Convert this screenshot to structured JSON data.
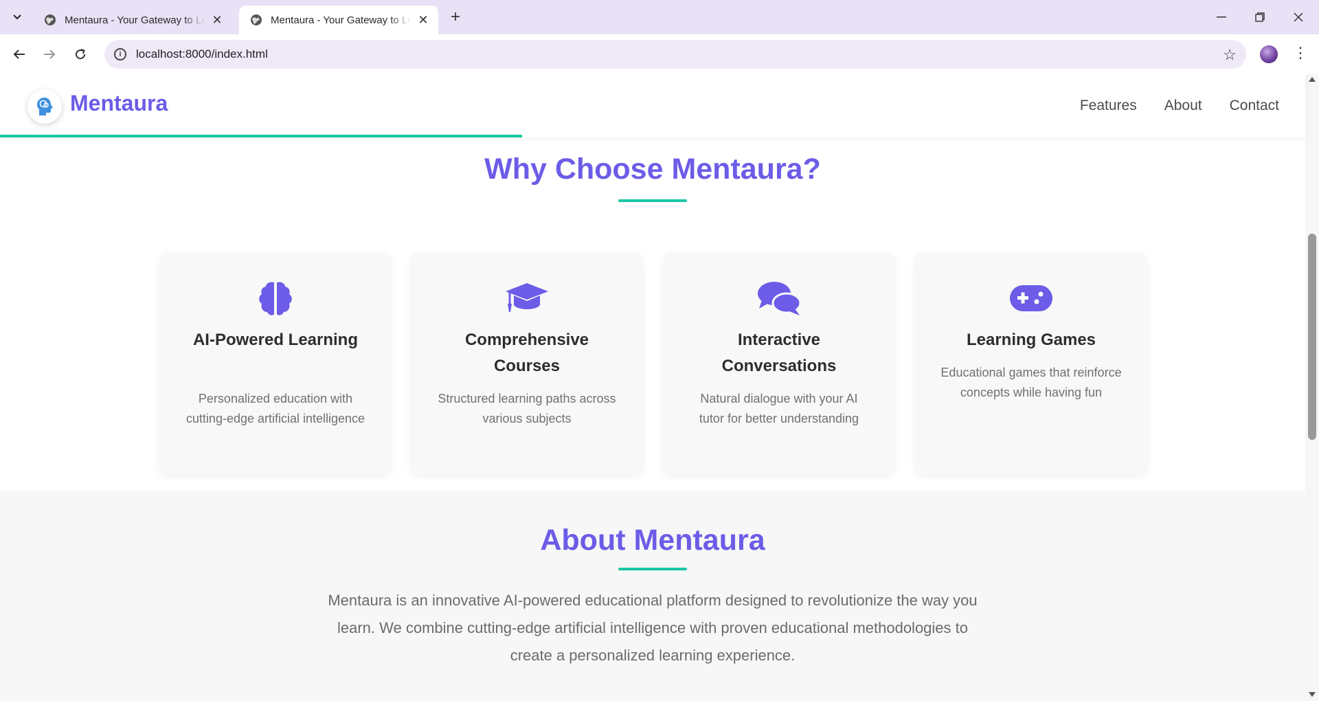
{
  "browser": {
    "tabs": [
      {
        "title": "Mentaura - Your Gateway to Learning",
        "active": false
      },
      {
        "title": "Mentaura - Your Gateway to Learning",
        "active": true
      }
    ],
    "url": "localhost:8000/index.html"
  },
  "site": {
    "brand": "Mentaura",
    "nav": [
      "Features",
      "About",
      "Contact"
    ],
    "scroll_progress": 0.4
  },
  "features": {
    "title": "Why Choose Mentaura?",
    "cards": [
      {
        "icon": "brain-icon",
        "title": "AI-Powered Learning",
        "text": "Personalized education with cutting-edge artificial intelligence"
      },
      {
        "icon": "graduation-cap-icon",
        "title": "Comprehensive Courses",
        "text": "Structured learning paths across various subjects"
      },
      {
        "icon": "comments-icon",
        "title": "Interactive Conversations",
        "text": "Natural dialogue with your AI tutor for better understanding"
      },
      {
        "icon": "gamepad-icon",
        "title": "Learning Games",
        "text": "Educational games that reinforce concepts while having fun"
      }
    ]
  },
  "about": {
    "title": "About Mentaura",
    "paragraph": "Mentaura is an innovative AI-powered educational platform designed to revolutionize the way you learn. We combine cutting-edge artificial intelligence with proven educational methodologies to create a personalized learning experience."
  },
  "colors": {
    "accent": "#6c5ce7",
    "teal": "#1cc7a5",
    "tab_bar": "#e9e1f6"
  }
}
